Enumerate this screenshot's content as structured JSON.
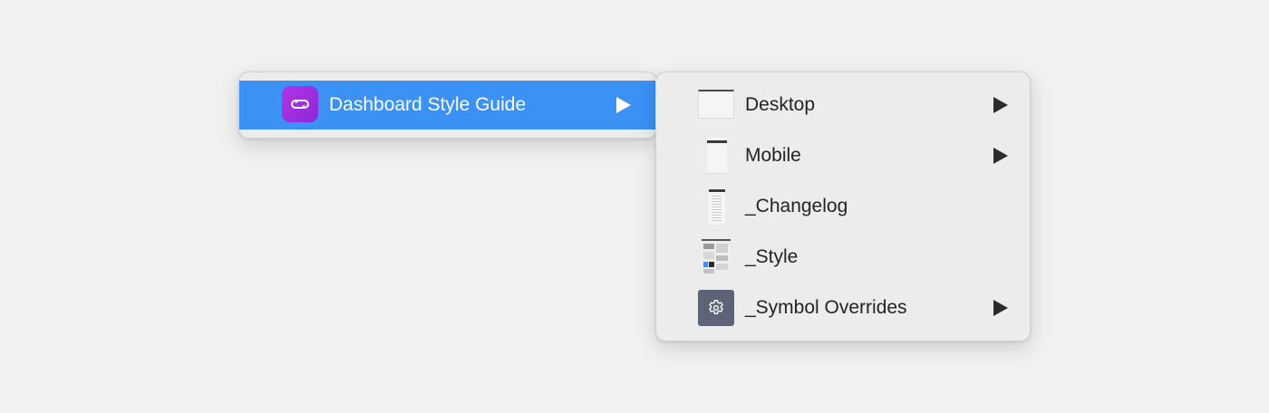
{
  "menu": {
    "parent_item": {
      "label": "Dashboard Style Guide",
      "icon": "link-icon"
    },
    "submenu_items": [
      {
        "label": "Desktop",
        "thumbnail": "desktop-page-thumbnail",
        "has_submenu": true
      },
      {
        "label": "Mobile",
        "thumbnail": "mobile-page-thumbnail",
        "has_submenu": true
      },
      {
        "label": "_Changelog",
        "thumbnail": "changelog-page-thumbnail",
        "has_submenu": false
      },
      {
        "label": "_Style",
        "thumbnail": "style-page-thumbnail",
        "has_submenu": false
      },
      {
        "label": "_Symbol Overrides",
        "thumbnail": "gear-icon",
        "has_submenu": true
      }
    ]
  },
  "colors": {
    "background": "#f1f1f1",
    "highlight": "#3c91f4",
    "app_icon": "#a02fe0",
    "menu_bg": "#ececec",
    "gear_tile": "#5d6478"
  }
}
